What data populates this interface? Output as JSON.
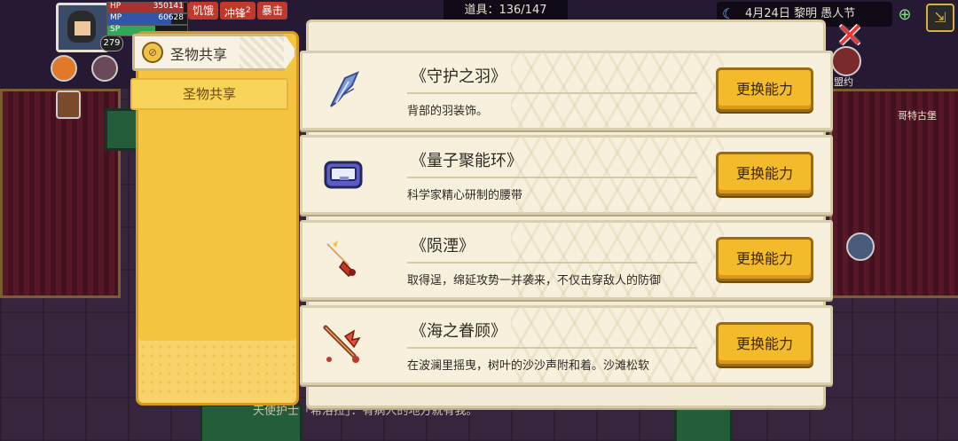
{
  "hud": {
    "level": "279",
    "stats": [
      {
        "label": "HP",
        "value": "350141",
        "color": "#d83a3a",
        "fill": 0.95
      },
      {
        "label": "MP",
        "value": "60628",
        "color": "#3a6ad8",
        "fill": 0.8
      },
      {
        "label": "SP",
        "value": "",
        "color": "#3ad86a",
        "fill": 0.6
      }
    ],
    "status_tags": [
      {
        "label": "饥饿",
        "color": "#c0392b"
      },
      {
        "label": "冲锋",
        "superscript": "2",
        "color": "#c0392b"
      },
      {
        "label": "暴击",
        "color": "#c0392b"
      }
    ],
    "items_label": "道具：136/147",
    "date": "4月24日 黎明 愚人节",
    "map_labels": [
      "盟约",
      "哥特古堡"
    ]
  },
  "side_panel": {
    "active_tab": "圣物共享",
    "sub_tab": "圣物共享"
  },
  "cards": [
    {
      "name": "《守护之羽》",
      "desc": "背部的羽装饰。",
      "button": "更换能力",
      "icon": "feather-icon"
    },
    {
      "name": "《量子聚能环》",
      "desc": "科学家精心研制的腰带",
      "button": "更换能力",
      "icon": "belt-icon"
    },
    {
      "name": "《陨湮》",
      "desc": "取得逞，绵延攻势一并袭来，不仅击穿敌人的防御",
      "button": "更换能力",
      "icon": "flame-sword-icon"
    },
    {
      "name": "《海之眷顾》",
      "desc": "在波澜里摇曳，树叶的沙沙声附和着。沙滩松软",
      "button": "更换能力",
      "icon": "coral-sword-icon"
    }
  ],
  "chat": "天使护士「希洛拉」：有病人的地方就有我。"
}
